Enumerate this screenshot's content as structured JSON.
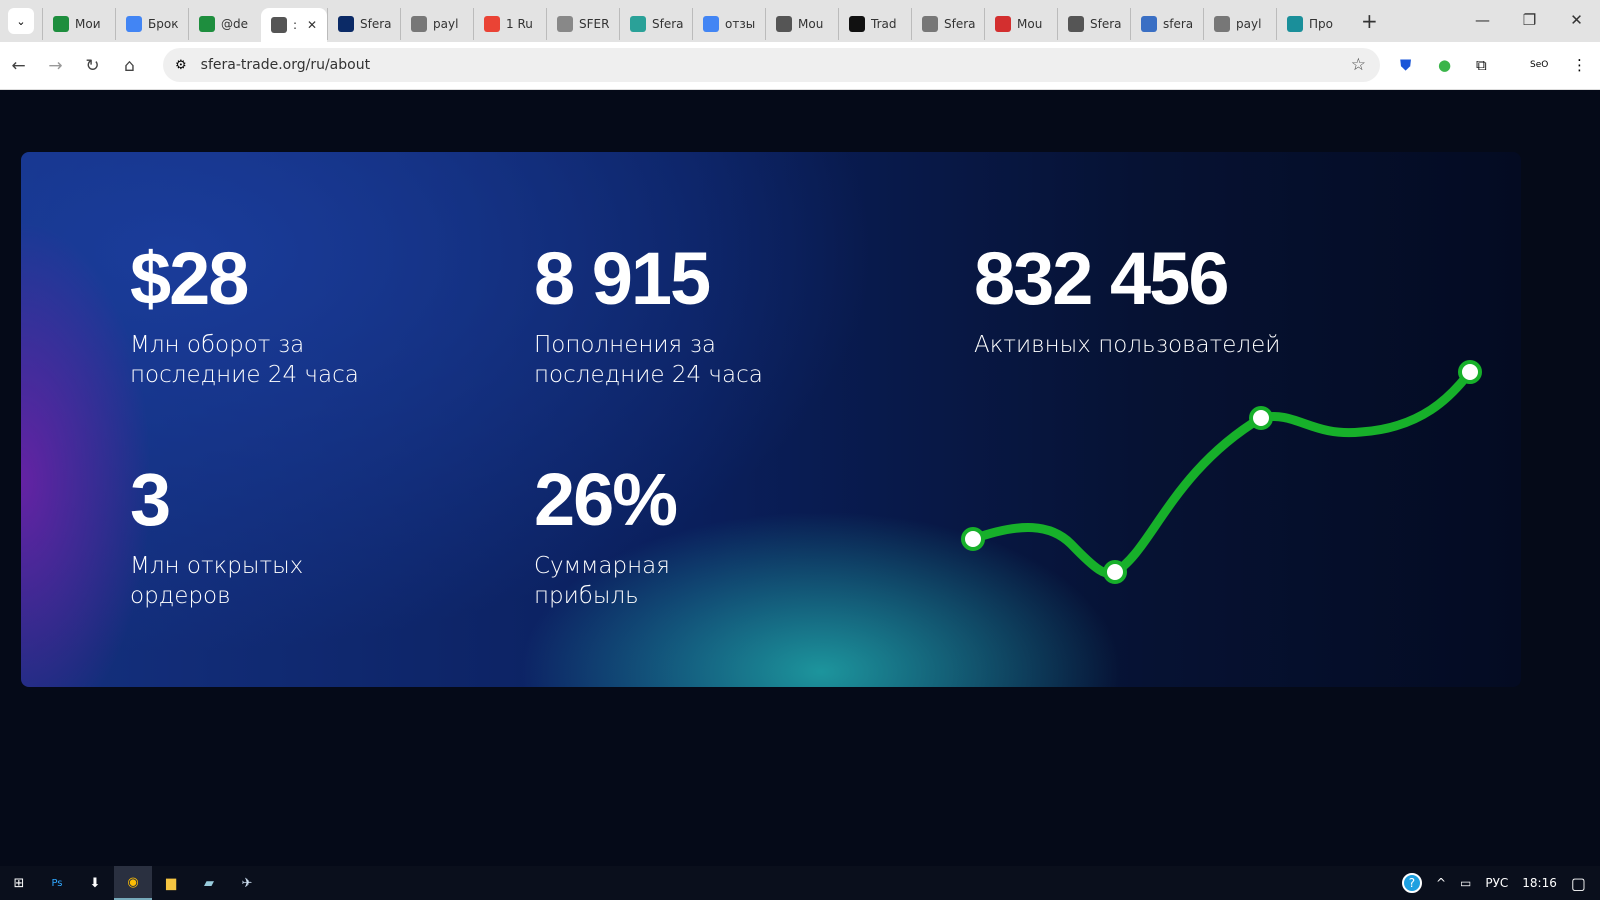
{
  "browser": {
    "tabs": [
      {
        "label": "Мои",
        "color": "#1e8e3e"
      },
      {
        "label": "Брок",
        "color": "#4285f4"
      },
      {
        "label": "@de",
        "color": "#1e8e3e"
      },
      {
        "label": ":",
        "color": "#555",
        "active": true
      },
      {
        "label": "Sfera",
        "color": "#0b2a66"
      },
      {
        "label": "payl",
        "color": "#777"
      },
      {
        "label": "1 Ru",
        "color": "#ea4335"
      },
      {
        "label": "SFER",
        "color": "#888"
      },
      {
        "label": "Sfera",
        "color": "#2aa198"
      },
      {
        "label": "отзы",
        "color": "#4285f4"
      },
      {
        "label": "Mou",
        "color": "#555"
      },
      {
        "label": "Trad",
        "color": "#111"
      },
      {
        "label": "Sfera",
        "color": "#777"
      },
      {
        "label": "Mou",
        "color": "#d32f2f"
      },
      {
        "label": "Sfera",
        "color": "#555"
      },
      {
        "label": "sfera",
        "color": "#3a6fc4"
      },
      {
        "label": "payl",
        "color": "#777"
      },
      {
        "label": "Про",
        "color": "#1a8f9a"
      }
    ],
    "url": "sfera-trade.org/ru/about"
  },
  "stats": [
    {
      "value": "$28",
      "label": "Млн оборот за последние 24 часа"
    },
    {
      "value": "8 915",
      "label": "Пополнения за последние 24 часа"
    },
    {
      "value": "832 456",
      "label": "Активных пользователей"
    },
    {
      "value": "3",
      "label": "Млн открытых ордеров"
    },
    {
      "value": "26%",
      "label": "Суммарная прибыль"
    }
  ],
  "accent": "#17b02a",
  "taskbar": {
    "lang": "РУС",
    "time": "18:16"
  }
}
